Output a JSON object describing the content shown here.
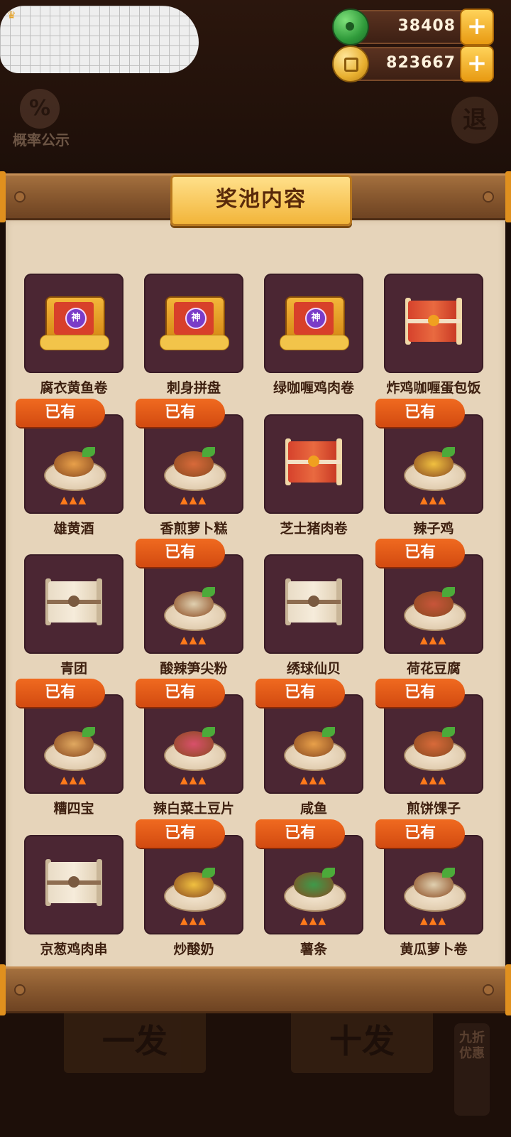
{
  "header": {
    "currencies": [
      {
        "name": "jade",
        "amount": "38408",
        "icon": "jade-coin-icon"
      },
      {
        "name": "coin",
        "amount": "823667",
        "icon": "copper-coin-icon"
      }
    ],
    "probability_label": "概率公示",
    "probability_icon": "%",
    "back_label": "退"
  },
  "panel": {
    "title": "奖池内容",
    "owned_label": "已有",
    "badge_label": "神",
    "items": [
      {
        "name": "腐衣黄鱼卷",
        "owned": false,
        "icon": "chest-icon"
      },
      {
        "name": "刺身拼盘",
        "owned": false,
        "icon": "chest-icon"
      },
      {
        "name": "绿咖喱鸡肉卷",
        "owned": false,
        "icon": "chest-icon"
      },
      {
        "name": "炸鸡咖喱蛋包饭",
        "owned": false,
        "icon": "red-scroll-icon"
      },
      {
        "name": "雄黄酒",
        "owned": true,
        "icon": "wine-jar-icon"
      },
      {
        "name": "香煎萝卜糕",
        "owned": true,
        "icon": "dish-icon"
      },
      {
        "name": "芝士猪肉卷",
        "owned": false,
        "icon": "red-scroll-icon"
      },
      {
        "name": "辣子鸡",
        "owned": true,
        "icon": "dish-icon"
      },
      {
        "name": "青团",
        "owned": false,
        "icon": "scroll-icon"
      },
      {
        "name": "酸辣笋尖粉",
        "owned": true,
        "icon": "dish-icon"
      },
      {
        "name": "绣球仙贝",
        "owned": false,
        "icon": "scroll-icon"
      },
      {
        "name": "荷花豆腐",
        "owned": true,
        "icon": "dish-icon"
      },
      {
        "name": "糟四宝",
        "owned": true,
        "icon": "dish-icon"
      },
      {
        "name": "辣白菜土豆片",
        "owned": true,
        "icon": "dish-icon"
      },
      {
        "name": "咸鱼",
        "owned": true,
        "icon": "fish-dish-icon"
      },
      {
        "name": "煎饼馃子",
        "owned": true,
        "icon": "dish-icon"
      },
      {
        "name": "京葱鸡肉串",
        "owned": false,
        "icon": "scroll-icon"
      },
      {
        "name": "炒酸奶",
        "owned": true,
        "icon": "dish-icon"
      },
      {
        "name": "薯条",
        "owned": true,
        "icon": "dish-icon"
      },
      {
        "name": "黄瓜萝卜卷",
        "owned": true,
        "icon": "dish-icon"
      }
    ]
  },
  "bottom": {
    "single_draw": "一发",
    "ten_draw": "十发",
    "discount_tag": "九折优惠"
  }
}
